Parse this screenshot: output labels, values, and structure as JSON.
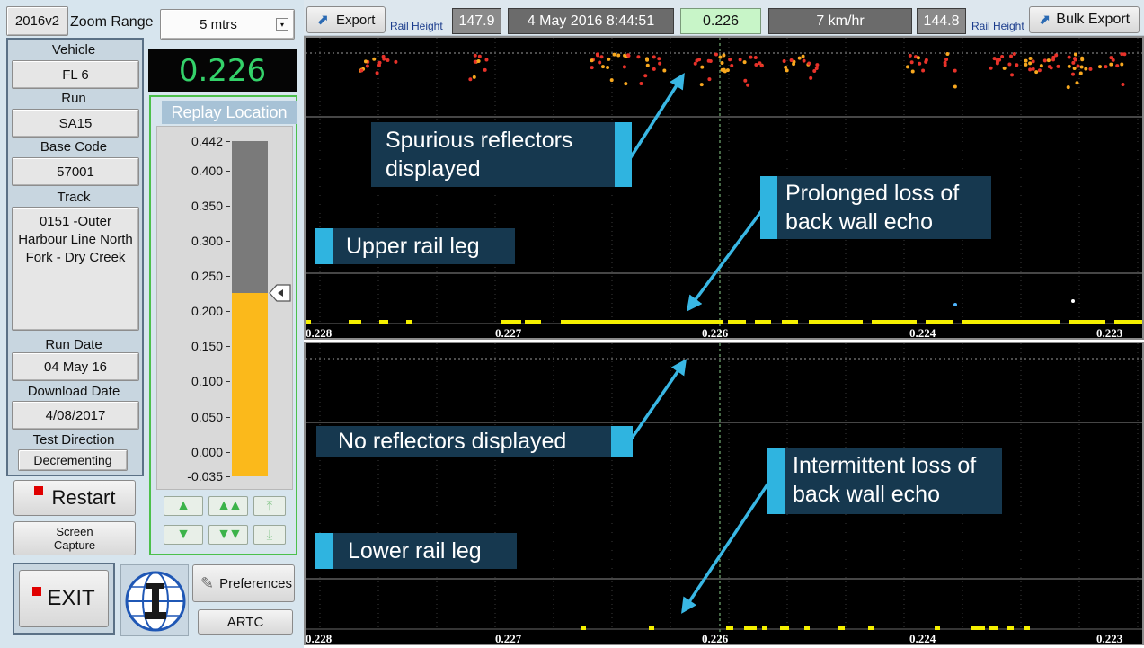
{
  "toolbar_left": {
    "version": "2016v2",
    "zoom_label": "Zoom Range",
    "zoom_value": "5 mtrs"
  },
  "readout": {
    "value": "0.226"
  },
  "vehicle": {
    "label": "Vehicle",
    "value": "FL 6"
  },
  "run": {
    "label": "Run",
    "value": "SA15"
  },
  "base_code": {
    "label": "Base Code",
    "value": "57001"
  },
  "track": {
    "label": "Track",
    "value": "0151 -Outer Harbour Line North Fork - Dry Creek"
  },
  "run_date": {
    "label": "Run Date",
    "value": "04 May 16"
  },
  "download_date": {
    "label": "Download Date",
    "value": "4/08/2017"
  },
  "test_direction": {
    "label": "Test Direction",
    "value": "Decrementing"
  },
  "buttons": {
    "restart": "Restart",
    "screen_capture": "Screen Capture",
    "exit": "EXIT",
    "preferences": "Preferences",
    "artc": "ARTC"
  },
  "replay": {
    "title": "Replay Location",
    "ticks": [
      "0.442",
      "0.400",
      "0.350",
      "0.300",
      "0.250",
      "0.200",
      "0.150",
      "0.100",
      "0.050",
      "0.000",
      "-0.035"
    ],
    "current_value": 0.226,
    "min": -0.035,
    "max": 0.442
  },
  "header": {
    "export": "Export",
    "rail_height_left_label": "Rail Height",
    "rail_height_left": "147.9",
    "datetime": "4 May 2016 8:44:51",
    "position": "0.226",
    "speed": "7 km/hr",
    "rail_height_right": "144.8",
    "rail_height_right_label": "Rail Height",
    "bulk_export": "Bulk Export"
  },
  "colors": {
    "readout_green": "#34d26a",
    "gauge_fill": "#fbb91b",
    "callout_bg": "#16384f",
    "callout_accent": "#2fb4e0",
    "echo_yellow": "#f5f000",
    "reflector_red": "#e8322a",
    "reflector_orange": "#f8a81f"
  },
  "upper_chart": {
    "axis_labels": [
      "0.228",
      "0.227",
      "0.226",
      "0.224",
      "0.223"
    ]
  },
  "lower_chart": {
    "axis_labels": [
      "0.228",
      "0.227",
      "0.226",
      "0.224",
      "0.223"
    ]
  },
  "callouts": {
    "spurious": "Spurious reflectors displayed",
    "prolonged": "Prolonged loss of back wall echo",
    "upper_leg": "Upper rail leg",
    "no_reflectors": "No reflectors displayed",
    "intermittent": "Intermittent loss of back wall echo",
    "lower_leg": "Lower rail leg"
  }
}
